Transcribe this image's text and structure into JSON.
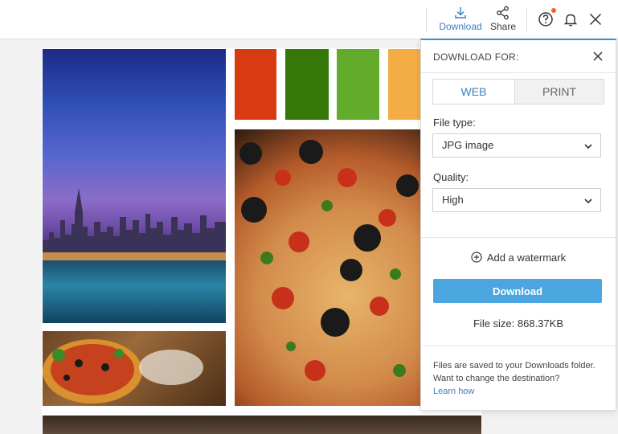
{
  "toolbar": {
    "download_label": "Download",
    "share_label": "Share"
  },
  "collage": {
    "swatch_colors": [
      "#d83b12",
      "#367808",
      "#62ab2b",
      "#f4ad45"
    ]
  },
  "panel": {
    "title": "DOWNLOAD FOR:",
    "tabs": [
      {
        "label": "WEB",
        "active": true
      },
      {
        "label": "PRINT",
        "active": false
      }
    ],
    "file_type": {
      "label": "File type:",
      "value": "JPG image"
    },
    "quality": {
      "label": "Quality:",
      "value": "High"
    },
    "watermark_label": "Add a watermark",
    "download_button": "Download",
    "file_size": "File size: 868.37KB",
    "note": "Files are saved to your Downloads folder. Want to change the destination?",
    "learn_more": "Learn how"
  },
  "colors": {
    "accent": "#3d7fbf",
    "button": "#4ba6e0",
    "notification": "#ff5a1f"
  },
  "icons": [
    "download-icon",
    "share-icon",
    "help-icon",
    "bell-icon",
    "close-icon",
    "chevron-down-icon",
    "add-circle-icon"
  ]
}
